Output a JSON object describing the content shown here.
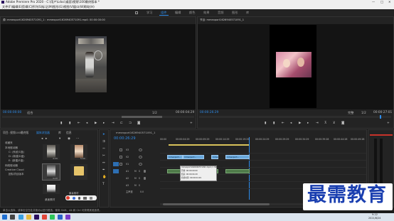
{
  "window": {
    "title": "Adobe Premiere Pro 2020 - C:\\用户\\Ldoc\\桌面\\视频\\100最终版本 *",
    "controls": [
      "—",
      "□",
      "✕"
    ]
  },
  "menu": [
    "文件(F)",
    "编辑(E)",
    "剪辑(C)",
    "序列(S)",
    "标记(M)",
    "图形(G)",
    "视图(V)",
    "窗口(W)",
    "帮助(H)"
  ],
  "workspaces": [
    "学习",
    "组件",
    "编辑",
    "颜色",
    "效果",
    "音频",
    "图形",
    "库"
  ],
  "active_workspace_index": 1,
  "source_monitor": {
    "tab": "源: mmexport1626940571091_1：mmexport1626940571091.mp4: 00:00:00:00",
    "timecode": "00:00:00:00",
    "fit": "适合",
    "fraction": "1/2",
    "duration": "00:00:04:29"
  },
  "program_monitor": {
    "tab": "节目: mmexport1626940571091_1",
    "timecode": "00:00:26:29",
    "fit": "完整",
    "fraction": "1/2",
    "duration": "00:00:27:01"
  },
  "project_panel": {
    "tabs": [
      "项目: 视频100最终版",
      "媒体浏览器",
      "库",
      "信息"
    ],
    "tree": [
      "收藏夹",
      "本地驱动器",
      "C: (系统/C盘)",
      "D: (新建/D盘)",
      "E: (新建/E盘)",
      "网络驱动器",
      "Creative Cloud",
      "团队项目版本"
    ],
    "items": [
      {
        "name": "mmexport…",
        "dur": "4:29"
      },
      {
        "name": "mmexport…",
        "dur": "5:00"
      },
      {
        "name": "mmexport…",
        "dur": "3:10"
      },
      {
        "name": "新建文件夹",
        "dur": ""
      },
      {
        "name": "",
        "dur": ""
      },
      {
        "name": "最喜素材",
        "dur": ""
      }
    ],
    "path": "桌面素材"
  },
  "timeline": {
    "tab": "mmexport1626940571091_1",
    "timecode": "00:00:26:29",
    "ruler": [
      "00:00",
      "00:00:04:29",
      "00:00:09:29",
      "00:00:14:29",
      "00:00:19:29",
      "00:00:24:29",
      "00:00:29:29",
      "00:00:34:29",
      "00:00:39:28",
      "00:00:44:28",
      "00:00:49:28"
    ],
    "tracks_video": [
      "V3",
      "V2",
      "V1"
    ],
    "tracks_audio": [
      "A1",
      "A2",
      "A3"
    ],
    "master": "主声道",
    "master_val": "0.0",
    "clip_labels": [
      "mmexport…",
      "mmexport…",
      "mmex…",
      "mmexport…"
    ],
    "tooltip": {
      "name": "mmexport1626940571091.mp4 (1 3457438)",
      "start": "开始: 00:00:00:00",
      "end": "结束: 00:00:04:29",
      "duration": "持续时间: 00:00:04:29"
    }
  },
  "status_bar": "单击以选择，或单击空白处并拖动以进行框选。使用 Shift、Alt 和 Ctrl 可获得其他选项。",
  "watermark": "最需教育",
  "taskbar": {
    "time": "9:22",
    "date": "2021/8/24"
  },
  "colors": {
    "accent": "#2d8ceb",
    "video_clip": "#6aa9dc",
    "audio_clip": "#4f7b4a",
    "watermark": "#1a3fb0"
  }
}
